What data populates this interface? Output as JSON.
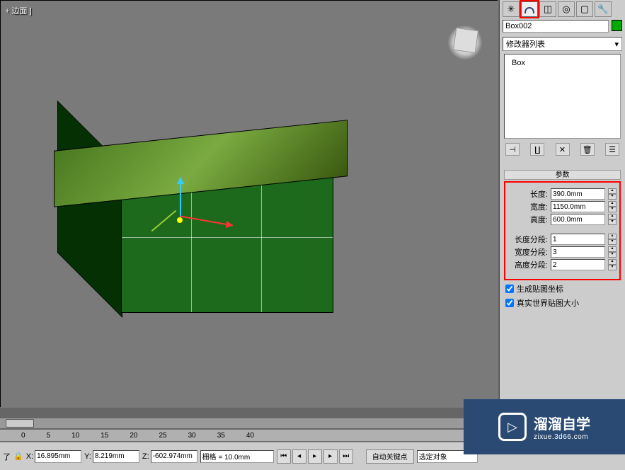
{
  "viewport": {
    "label": "+ 边面 ]"
  },
  "object": {
    "name": "Box002"
  },
  "modifier": {
    "dropdown_label": "修改器列表",
    "stack_item": "Box"
  },
  "rollout": {
    "title": "参数"
  },
  "params": {
    "length_label": "长度:",
    "length_value": "390.0mm",
    "width_label": "宽度:",
    "width_value": "1150.0mm",
    "height_label": "高度:",
    "height_value": "600.0mm",
    "lsegs_label": "长度分段:",
    "lsegs_value": "1",
    "wsegs_label": "宽度分段:",
    "wsegs_value": "3",
    "hsegs_label": "高度分段:",
    "hsegs_value": "2",
    "gen_uv_label": "生成贴图坐标",
    "real_world_label": "真实世界贴图大小"
  },
  "status": {
    "prompt_left": "了",
    "x_label": "X:",
    "x_value": "16.895mm",
    "y_label": "Y:",
    "y_value": "8.219mm",
    "z_label": "Z:",
    "z_value": "-602.974mm",
    "grid_label": "栅格 = 10.0mm",
    "autokey_label": "自动关键点",
    "selection_label": "选定对象"
  },
  "trackbar": {
    "t0": "0",
    "t5": "5",
    "t10": "10",
    "t15": "15",
    "t20": "20",
    "t25": "25",
    "t30": "30",
    "t35": "35",
    "t40": "40"
  },
  "watermark": {
    "title": "溜溜自学",
    "url": "zixue.3d66.com"
  }
}
